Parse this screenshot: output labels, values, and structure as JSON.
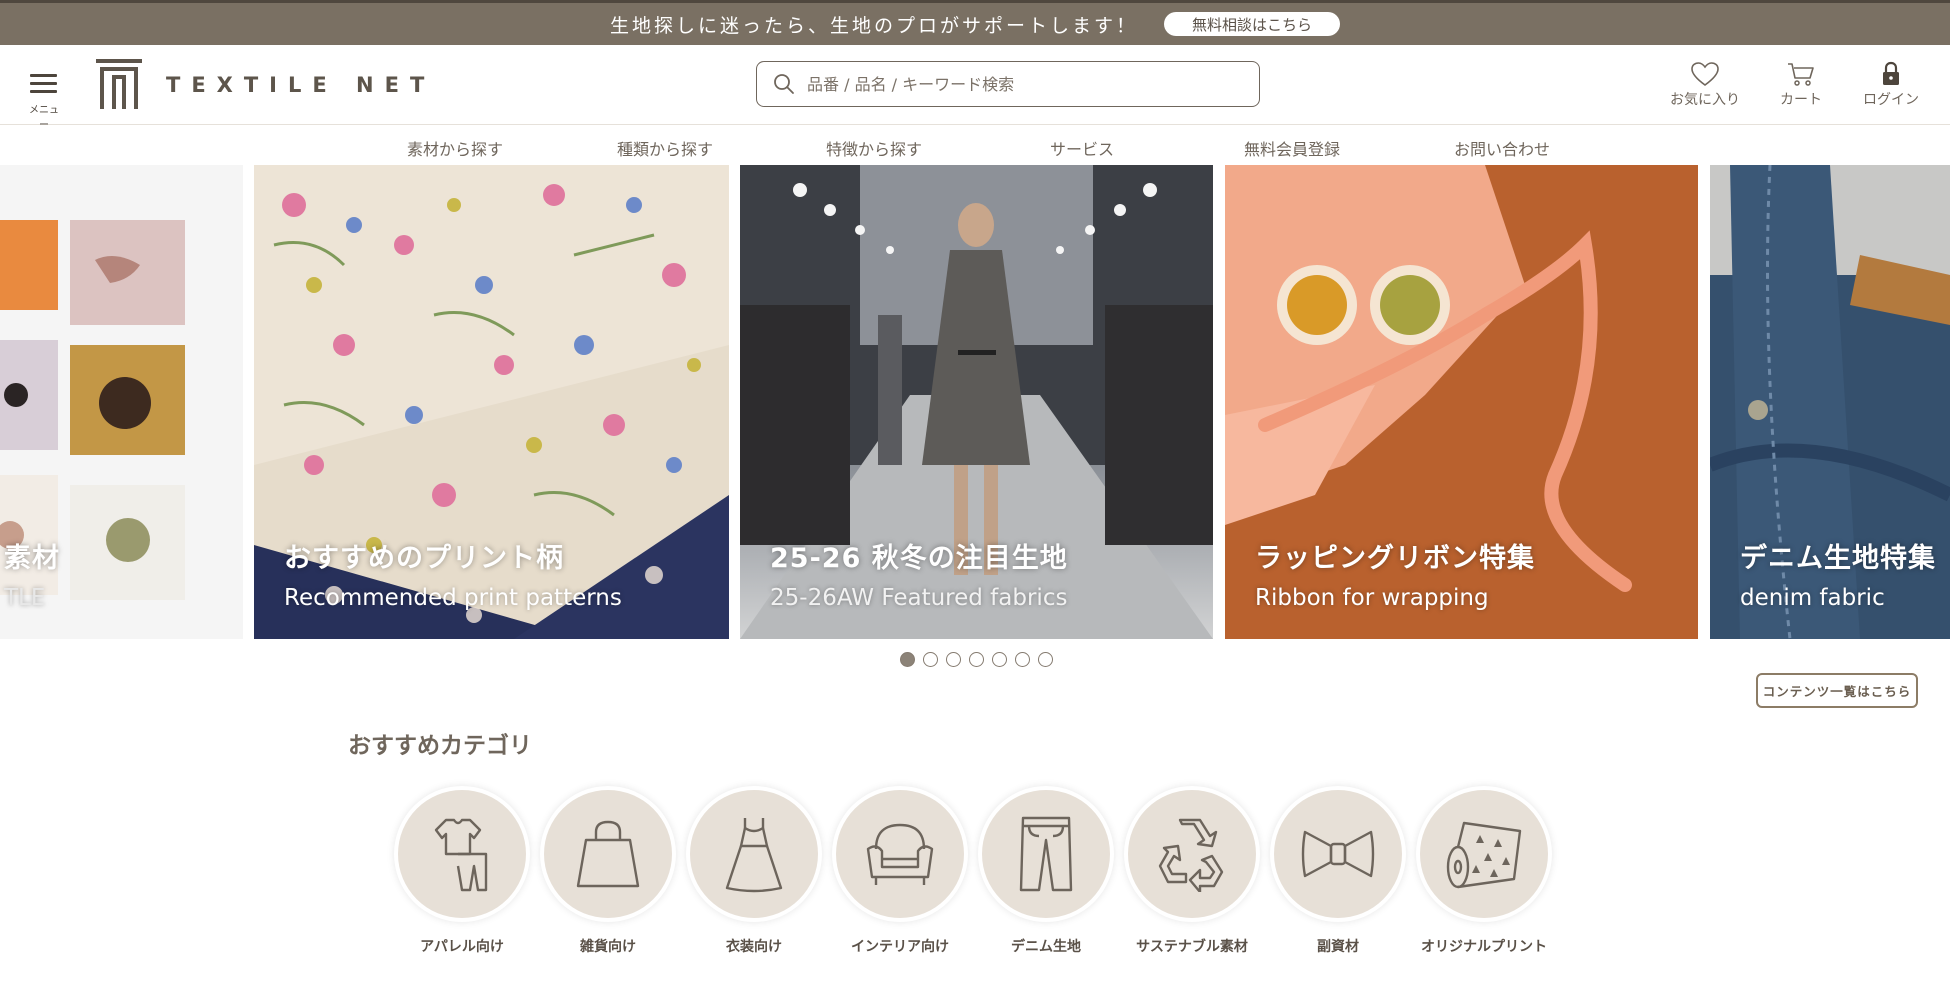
{
  "topbar": {
    "message": "生地探しに迷ったら、生地のプロがサポートします！",
    "cta_label": "無料相談はこちら"
  },
  "header": {
    "menu_label": "メニュー",
    "logo_text": "TEXTILE NET",
    "search_placeholder": "品番 / 品名 / キーワード検索",
    "icons": [
      {
        "label": "お気に入り",
        "icon": "heart-icon"
      },
      {
        "label": "カート",
        "icon": "cart-icon"
      },
      {
        "label": "ログイン",
        "icon": "lock-icon"
      }
    ]
  },
  "nav": {
    "items": [
      "素材から探す",
      "種類から探す",
      "特徴から探す",
      "サービス",
      "無料会員登録",
      "お問い合わせ"
    ]
  },
  "carousel": {
    "slides": [
      {
        "title": "素材",
        "subtitle": "TLE"
      },
      {
        "title": "おすすめのプリント柄",
        "subtitle": "Recommended print patterns"
      },
      {
        "title": "25-26 秋冬の注目生地",
        "subtitle": "25-26AW Featured fabrics"
      },
      {
        "title": "ラッピングリボン特集",
        "subtitle": "Ribbon for wrapping"
      },
      {
        "title": "デニム生地特集",
        "subtitle": "denim fabric"
      }
    ],
    "dot_count": 7,
    "active_dot": 0
  },
  "content_link_label": "コンテンツ一覧はこちら",
  "section_title": "おすすめカテゴリ",
  "categories": [
    {
      "label": "アパレル向け",
      "icon": "clothing-icon"
    },
    {
      "label": "雑貨向け",
      "icon": "bag-icon"
    },
    {
      "label": "衣装向け",
      "icon": "dress-icon"
    },
    {
      "label": "インテリア向け",
      "icon": "armchair-icon"
    },
    {
      "label": "デニム生地",
      "icon": "jeans-icon"
    },
    {
      "label": "サステナブル素材",
      "icon": "recycle-icon"
    },
    {
      "label": "副資材",
      "icon": "bow-icon"
    },
    {
      "label": "オリジナルプリント",
      "icon": "fabric-roll-icon"
    }
  ],
  "colors": {
    "topbar": "#7a7063",
    "text": "#5a5148",
    "category_circle": "#e7e0d7"
  }
}
